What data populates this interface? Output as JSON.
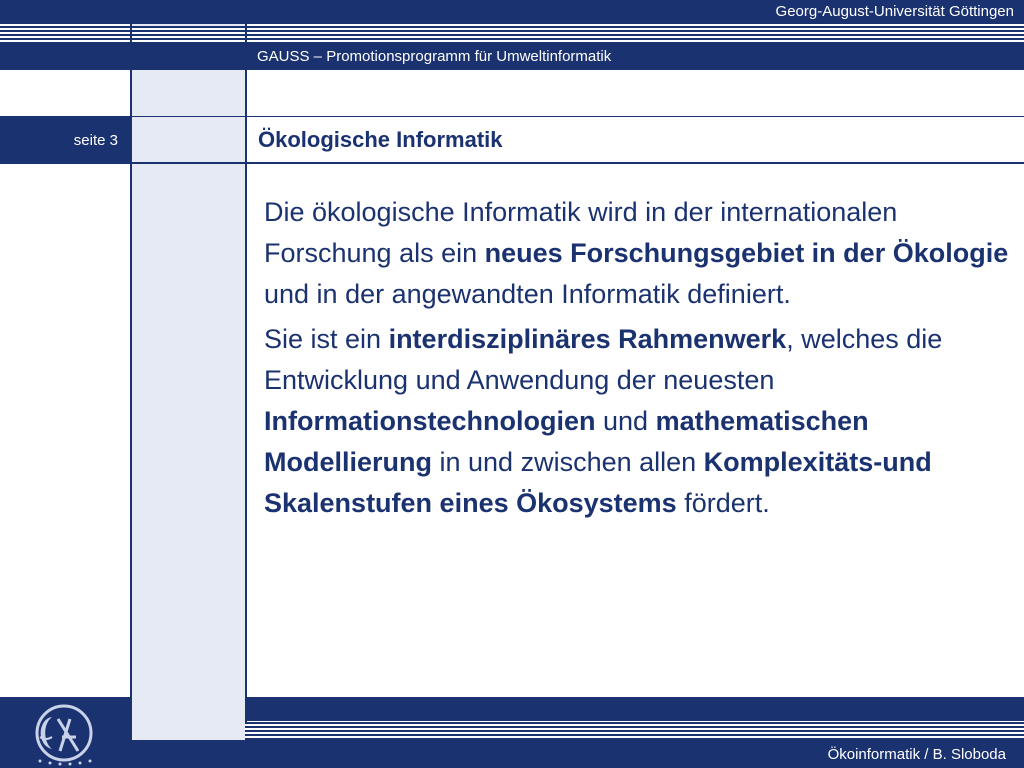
{
  "header": {
    "university": "Georg-August-Universität Göttingen",
    "program": "GAUSS – Promotionsprogramm für Umweltinformatik"
  },
  "sidebar": {
    "page_label": "seite 3"
  },
  "slide": {
    "title": "Ökologische Informatik",
    "paragraph1": {
      "t1": "Die ökologische Informatik wird in der internationalen Forschung als ein ",
      "b1": "neues Forschungsgebiet in der Ökologie",
      "t2": " und in der angewandten Informatik definiert."
    },
    "paragraph2": {
      "t1": "Sie ist ein ",
      "b1": "interdisziplinäres Rahmenwerk",
      "t2": ", welches die Entwicklung und Anwendung der neuesten ",
      "b2": "Informationstechnologien",
      "t3": " und ",
      "b3": "mathematischen Modellierung",
      "t4": " in und zwischen allen ",
      "b4": "Komplexitäts-und Skalenstufen eines Ökosystems",
      "t5": " fördert."
    }
  },
  "footer": {
    "author": "Ökoinformatik / B. Sloboda"
  },
  "icons": {
    "logo": "university-seal-icon"
  },
  "colors": {
    "navy": "#1b3270",
    "light_column": "#e6eaf4",
    "background": "#ffffff"
  }
}
